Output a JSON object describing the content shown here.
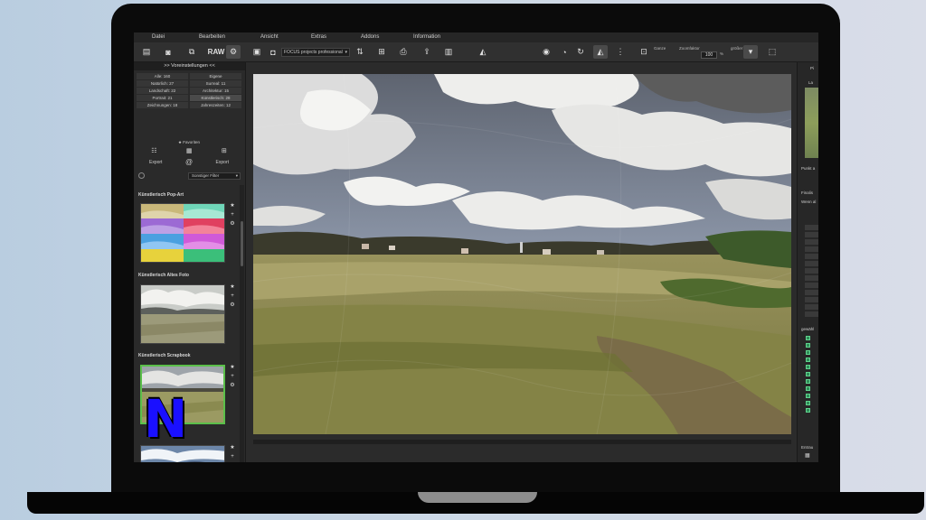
{
  "menu": [
    "Datei",
    "Bearbeiten",
    "Ansicht",
    "Extras",
    "Addons",
    "Information"
  ],
  "toolbar": {
    "raw_label": "RAW",
    "preset_select": "FOCUS projects professional",
    "zoom_label": "Zoomfaktor",
    "zoom_value": "100",
    "zoom_unit": "%",
    "left_label": "Ganze",
    "right_label": "größer"
  },
  "left_panel": {
    "header": ">> Voreinstellungen <<",
    "categories": [
      "Alle: 160",
      "Eigene",
      "Natürlich: 27",
      "Surreal: 11",
      "Landschaft: 22",
      "Architektur: 15",
      "Portrait: 21",
      "Künstlerisch: 28",
      "Zeichnungen: 18",
      "Jahreszeiten: 12"
    ],
    "favorites_label": "Favoriten",
    "export_label": "Export",
    "at_symbol": "@",
    "import_label": "Export",
    "filter_select": "Sonstiger Filter",
    "sections": [
      {
        "title": "Künstlerisch Pop-Art"
      },
      {
        "title": "Künstlerisch Altes Foto"
      },
      {
        "title": "Künstlerisch Scrapbook"
      }
    ]
  },
  "right_panel": {
    "texts": [
      "Pi",
      "La",
      "Punkt a",
      "Finalis",
      "Wenn al",
      "gewähl",
      "Entrau"
    ]
  },
  "logo_text": "N",
  "colors": {
    "selection_border": "#5bbf4a",
    "logo_blue": "#1a10ff",
    "app_bg": "#2b2b2b"
  }
}
